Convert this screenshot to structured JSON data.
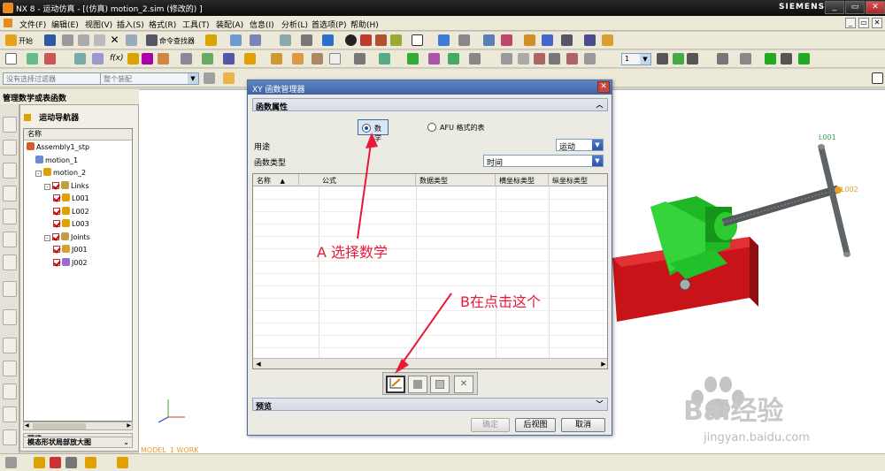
{
  "window": {
    "title": "NX 8 - 运动仿真 - [(仿真) motion_2.sim  (修改的) ]",
    "brand": "SIEMENS",
    "controls": [
      "_",
      "▭",
      "✕"
    ],
    "doc_controls": [
      "_",
      "▭",
      "✕"
    ]
  },
  "menubar": {
    "items": [
      "文件(F)",
      "编辑(E)",
      "视图(V)",
      "插入(S)",
      "格式(R)",
      "工具(T)",
      "装配(A)",
      "信息(I)",
      "分析(L)",
      "首选项(P)",
      "帮助(H)"
    ]
  },
  "toolbar1": {
    "start_label": "开始",
    "command_finder_label": "命令查找器"
  },
  "toolbar2": {
    "layer_value": "1"
  },
  "toolbar3": {
    "filter_placeholder": "没有选择过滤器",
    "assembly_filter": "整个装配"
  },
  "resource_bar": {
    "title": "管理数学或表函数"
  },
  "navigator": {
    "title": "运动导航器",
    "column": "名称",
    "nodes": [
      {
        "label": "Assembly1_stp",
        "indent": 0,
        "toggle": "",
        "checked": false
      },
      {
        "label": "motion_1",
        "indent": 1,
        "toggle": "",
        "checked": false
      },
      {
        "label": "motion_2",
        "indent": 1,
        "toggle": "-",
        "checked": false
      },
      {
        "label": "Links",
        "indent": 2,
        "toggle": "-",
        "checked": true
      },
      {
        "label": "L001",
        "indent": 3,
        "toggle": "",
        "checked": true
      },
      {
        "label": "L002",
        "indent": 3,
        "toggle": "",
        "checked": true
      },
      {
        "label": "L003",
        "indent": 3,
        "toggle": "",
        "checked": true
      },
      {
        "label": "Joints",
        "indent": 2,
        "toggle": "-",
        "checked": true
      },
      {
        "label": "J001",
        "indent": 3,
        "toggle": "",
        "checked": true
      },
      {
        "label": "J002",
        "indent": 3,
        "toggle": "",
        "checked": true
      }
    ],
    "preview_label": "预览",
    "mode_label": "模态形状局部放大图"
  },
  "viewport": {
    "work_label": "MODEL_1 WORK",
    "labels": [
      "L001",
      "L002"
    ],
    "colors": {
      "green": "#22c02a",
      "red": "#c81418",
      "gray": "#5e6467"
    }
  },
  "dialog": {
    "title": "XY 函数管理器",
    "group_props": "函数属性",
    "radio_math": "数学",
    "radio_afu": "AFU 格式的表",
    "purpose_label": "用途",
    "purpose_value": "运动",
    "type_label": "函数类型",
    "type_value": "时间",
    "columns": [
      "名称",
      "公式",
      "数据类型",
      "横坐标类型",
      "纵坐标类型"
    ],
    "action_icons": [
      "new-function-icon",
      "edit-wrench-icon",
      "copy-icon",
      "delete-icon"
    ],
    "delete_glyph": "✕",
    "group_preview": "预览",
    "ok_label": "确定",
    "back_label": "后视图",
    "cancel_label": "取消"
  },
  "annotations": {
    "a_text": "A 选择数学",
    "b_text": "B在点击这个"
  },
  "watermark": {
    "text": "Bai经验",
    "url": "jingyan.baidu.com"
  }
}
